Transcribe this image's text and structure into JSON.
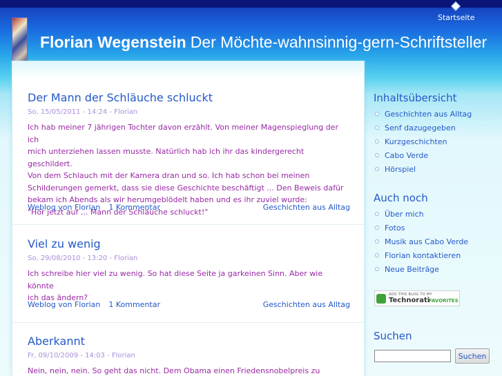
{
  "nav": {
    "home": "Startseite"
  },
  "site": {
    "name": "Florian Wegenstein",
    "slogan": "Der Möchte-wahnsinnig-gern-Schriftsteller"
  },
  "posts": [
    {
      "title": "Der Mann der Schläuche schluckt",
      "meta": "So, 15/05/2011 - 14:24 - Florian",
      "body": [
        "Ich hab meiner 7 jährigen Tochter davon erzählt. Von meiner Magenspieglung der ich",
        "mich unterziehen lassen musste. Natürlich hab ich ihr das kindergerecht geschildert.",
        "Von dem Schlauch mit der Kamera dran und so. Ich hab schon bei meinen",
        "Schilderungen gemerkt, dass sie diese Geschichte beschäftigt ... Den Beweis dafür",
        "bekam ich Abends als wir herumgeblödelt haben und es ihr zuviel wurde:",
        "\"Hör jetzt auf ... Mann der Schläuche schluckt!\""
      ],
      "blog_link": "Weblog von Florian",
      "comments": "1 Kommentar",
      "category": "Geschichten aus Alltag"
    },
    {
      "title": "Viel zu wenig",
      "meta": "So, 29/08/2010 - 13:20 - Florian",
      "body": [
        "Ich schreibe hier viel zu wenig. So hat diese Seite ja garkeinen Sinn. Aber wie könnte",
        "ich das ändern?"
      ],
      "blog_link": "Weblog von Florian",
      "comments": "1 Kommentar",
      "category": "Geschichten aus Alltag"
    },
    {
      "title": "Aberkannt",
      "meta": "Fr, 09/10/2009 - 14:03 - Florian",
      "body": [
        "Nein, nein, nein. So geht das nicht. Dem Obama einen Friedensnobelpreis zu"
      ]
    }
  ],
  "sidebar": {
    "toc": {
      "title": "Inhaltsübersicht",
      "items": [
        "Geschichten aus Alltag",
        "Senf dazugegeben",
        "Kurzgeschichten",
        "Cabo Verde",
        "Hörspiel"
      ]
    },
    "more": {
      "title": "Auch noch",
      "items": [
        "Über mich",
        "Fotos",
        "Musik aus Cabo Verde",
        "Florian kontaktieren",
        "Neue Beiträge"
      ]
    },
    "technorati": {
      "small": "ADD THIS BLOG TO MY",
      "name": "Technorati",
      "favorites": "FAVORITES"
    },
    "search": {
      "title": "Suchen",
      "value": "",
      "button": "Suchen"
    }
  },
  "colors": {
    "link": "#2358c9",
    "body_text": "#9928a4",
    "meta": "#aa8ed8",
    "header_dark": "#0b1577"
  }
}
